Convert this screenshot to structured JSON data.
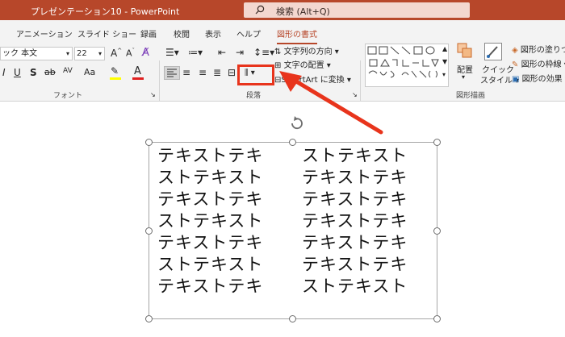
{
  "titlebar": {
    "document_title": "プレゼンテーション10  -  PowerPoint",
    "search_placeholder": "検索 (Alt+Q)"
  },
  "tabs": [
    {
      "label": "アニメーション"
    },
    {
      "label": "スライド ショー"
    },
    {
      "label": "録画"
    },
    {
      "label": "校閲"
    },
    {
      "label": "表示"
    },
    {
      "label": "ヘルプ"
    },
    {
      "label": "図形の書式"
    }
  ],
  "font_group": {
    "font_name": "ック 本文",
    "font_size": "22",
    "bold": "I",
    "underline": "U",
    "shadow": "S",
    "strike": "ab",
    "spacing": "AV",
    "case": "Aa",
    "group_label": "フォント"
  },
  "paragraph_group": {
    "text_direction": "文字列の方向",
    "align_text": "文字の配置",
    "smartart": "SmartArt に変換",
    "group_label": "段落"
  },
  "drawing_group": {
    "arrange": "配置",
    "quick_styles": "クイック",
    "quick_styles_line2": "スタイル",
    "shape_fill": "図形の塗りつ",
    "shape_outline": "図形の枠線",
    "shape_effects": "図形の効果",
    "group_label": "図形描画"
  },
  "textbox": {
    "left_column": [
      "テキストテキ",
      "ストテキスト",
      "テキストテキ",
      "ストテキスト",
      "テキストテキ",
      "ストテキスト",
      "テキストテキ"
    ],
    "right_column": [
      "ストテキスト",
      "テキストテキ",
      "テキストテキ",
      "テキストテキ",
      "テキストテキ",
      "テキストテキ",
      "ストテキスト"
    ]
  },
  "colors": {
    "titlebar": "#b7472a",
    "accent": "#b7472a",
    "annotation": "#e8341c",
    "highlight_pen": "#ffff00",
    "font_color": "#e02020"
  }
}
